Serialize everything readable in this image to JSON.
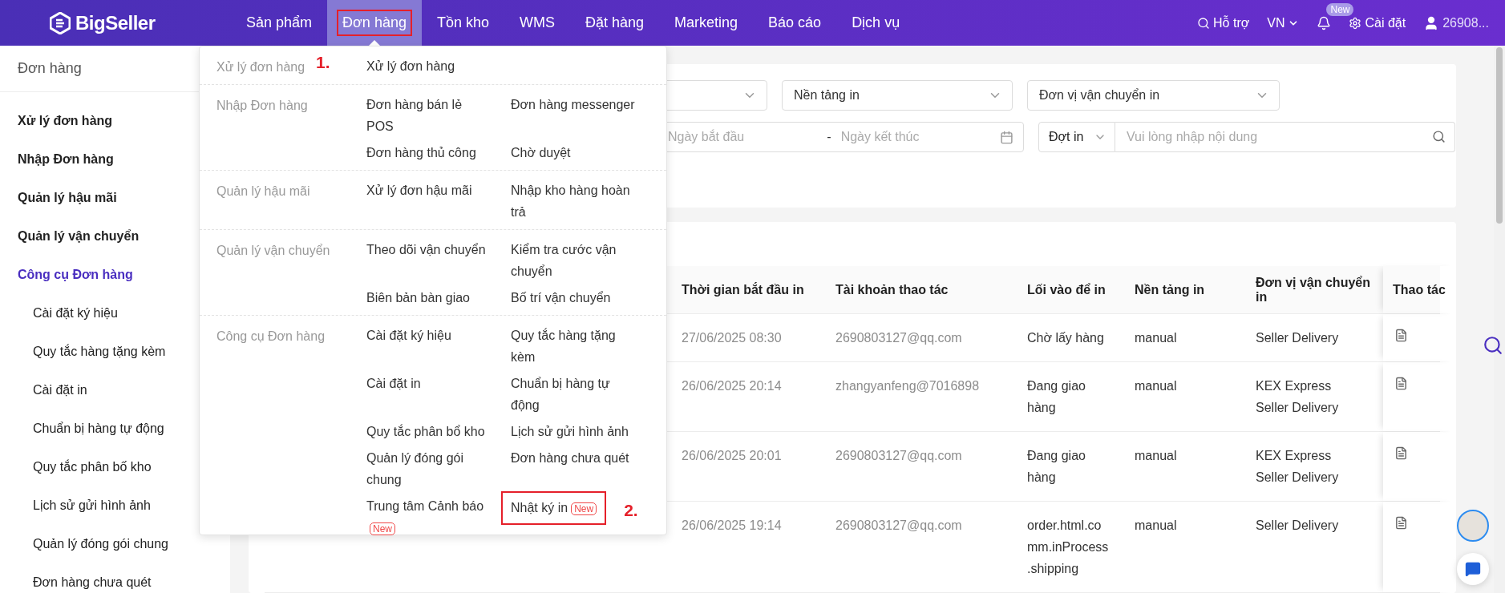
{
  "header": {
    "logo": "BigSeller",
    "nav": [
      {
        "label": "Sản phẩm",
        "selected": false,
        "annotated": false
      },
      {
        "label": "Đơn hàng",
        "selected": true,
        "annotated": true
      },
      {
        "label": "Tồn kho",
        "selected": false,
        "annotated": false
      },
      {
        "label": "WMS",
        "selected": false,
        "annotated": false
      },
      {
        "label": "Đặt hàng",
        "selected": false,
        "annotated": false
      },
      {
        "label": "Marketing",
        "selected": false,
        "annotated": false
      },
      {
        "label": "Báo cáo",
        "selected": false,
        "annotated": false
      },
      {
        "label": "Dịch vụ",
        "selected": false,
        "annotated": false
      }
    ],
    "support": "Hỗ trợ",
    "language": "VN",
    "bell_badge": "New",
    "settings": "Cài đặt",
    "user": "26908..."
  },
  "sidebar": {
    "title": "Đơn hàng",
    "items": [
      {
        "label": "Xử lý đơn hàng",
        "selected": false
      },
      {
        "label": "Nhập Đơn hàng",
        "selected": false
      },
      {
        "label": "Quản lý hậu mãi",
        "selected": false
      },
      {
        "label": "Quản lý vận chuyển",
        "selected": false
      },
      {
        "label": "Công cụ Đơn hàng",
        "selected": true,
        "children": [
          {
            "label": "Cài đặt ký hiệu"
          },
          {
            "label": "Quy tắc hàng tặng kèm"
          },
          {
            "label": "Cài đặt in"
          },
          {
            "label": "Chuẩn bị hàng tự động"
          },
          {
            "label": "Quy tắc phân bố kho"
          },
          {
            "label": "Lịch sử gửi hình ảnh"
          },
          {
            "label": "Quản lý đóng gói chung"
          },
          {
            "label": "Đơn hàng chưa quét"
          }
        ]
      }
    ]
  },
  "menu": {
    "note": "1.",
    "groups": [
      {
        "label": "Xử lý đơn hàng",
        "items": [
          {
            "label": "Xử lý đơn hàng",
            "annotated": false
          }
        ]
      },
      {
        "label": "Nhập Đơn hàng",
        "items": [
          {
            "label": "Đơn hàng bán lẻ POS",
            "annotated": false
          },
          {
            "label": "Đơn hàng messenger",
            "annotated": false
          },
          {
            "label": "Đơn hàng thủ công",
            "annotated": false
          },
          {
            "label": "Chờ duyệt",
            "annotated": false
          }
        ]
      },
      {
        "label": "Quản lý hậu mãi",
        "items": [
          {
            "label": "Xử lý đơn hậu mãi",
            "annotated": false
          },
          {
            "label": "Nhập kho hàng hoàn trả",
            "annotated": false
          }
        ]
      },
      {
        "label": "Quản lý vận chuyển",
        "items": [
          {
            "label": "Theo dõi vận chuyển",
            "annotated": false
          },
          {
            "label": "Kiểm tra cước vận chuyển",
            "annotated": false
          },
          {
            "label": "Biên bản bàn giao",
            "annotated": false
          },
          {
            "label": "Bố trí vận chuyển",
            "annotated": false
          }
        ]
      },
      {
        "label": "Công cụ Đơn hàng",
        "items": [
          {
            "label": "Cài đặt ký hiệu",
            "annotated": false
          },
          {
            "label": "Quy tắc hàng tặng kèm",
            "annotated": false
          },
          {
            "label": "Cài đặt in",
            "annotated": false
          },
          {
            "label": "Chuẩn bị hàng tự động",
            "annotated": false
          },
          {
            "label": "Quy tắc phân bổ kho",
            "annotated": false
          },
          {
            "label": "Lịch sử gửi hình ảnh",
            "annotated": false
          },
          {
            "label": "Quản lý đóng gói chung",
            "annotated": false
          },
          {
            "label": "Đơn hàng chưa quét",
            "annotated": false
          },
          {
            "label": "Trung tâm Cảnh báo",
            "badge": "New",
            "annotated": false
          },
          {
            "label": "Nhật ký in",
            "badge": "New",
            "annotated": true,
            "note": "2."
          }
        ]
      }
    ]
  },
  "filters": {
    "platform": {
      "label": "Nền tảng in"
    },
    "carrier": {
      "label": "Đơn vị vận chuyển in"
    },
    "date_range": {
      "start_placeholder": "Ngày bắt đầu",
      "separator": "-",
      "end_placeholder": "Ngày kết thúc"
    },
    "search": {
      "field": "Đợt in",
      "placeholder": "Vui lòng nhập nội dung"
    }
  },
  "table": {
    "columns": [
      "Thời gian bắt đầu in",
      "Tài khoản thao tác",
      "Lối vào để in",
      "Nền tảng in",
      "Đơn vị vận chuyển in",
      "Thao tác"
    ],
    "rows": [
      {
        "time": "27/06/2025 08:30",
        "account": "2690803127@qq.com",
        "entry": "Chờ lấy hàng",
        "platform": "manual",
        "carriers": [
          "Seller Delivery"
        ]
      },
      {
        "time": "26/06/2025 20:14",
        "account": "zhangyanfeng@7016898",
        "entry": "Đang giao hàng",
        "platform": "manual",
        "carriers": [
          "KEX Express",
          "Seller Delivery"
        ]
      },
      {
        "time": "26/06/2025 20:01",
        "account": "2690803127@qq.com",
        "entry": "Đang giao hàng",
        "platform": "manual",
        "carriers": [
          "KEX Express",
          "Seller Delivery"
        ]
      },
      {
        "time": "26/06/2025 19:14",
        "account": "2690803127@qq.com",
        "entry": "order.html.comm.inProcess.shipping",
        "platform": "manual",
        "carriers": [
          "Seller Delivery"
        ]
      }
    ]
  }
}
